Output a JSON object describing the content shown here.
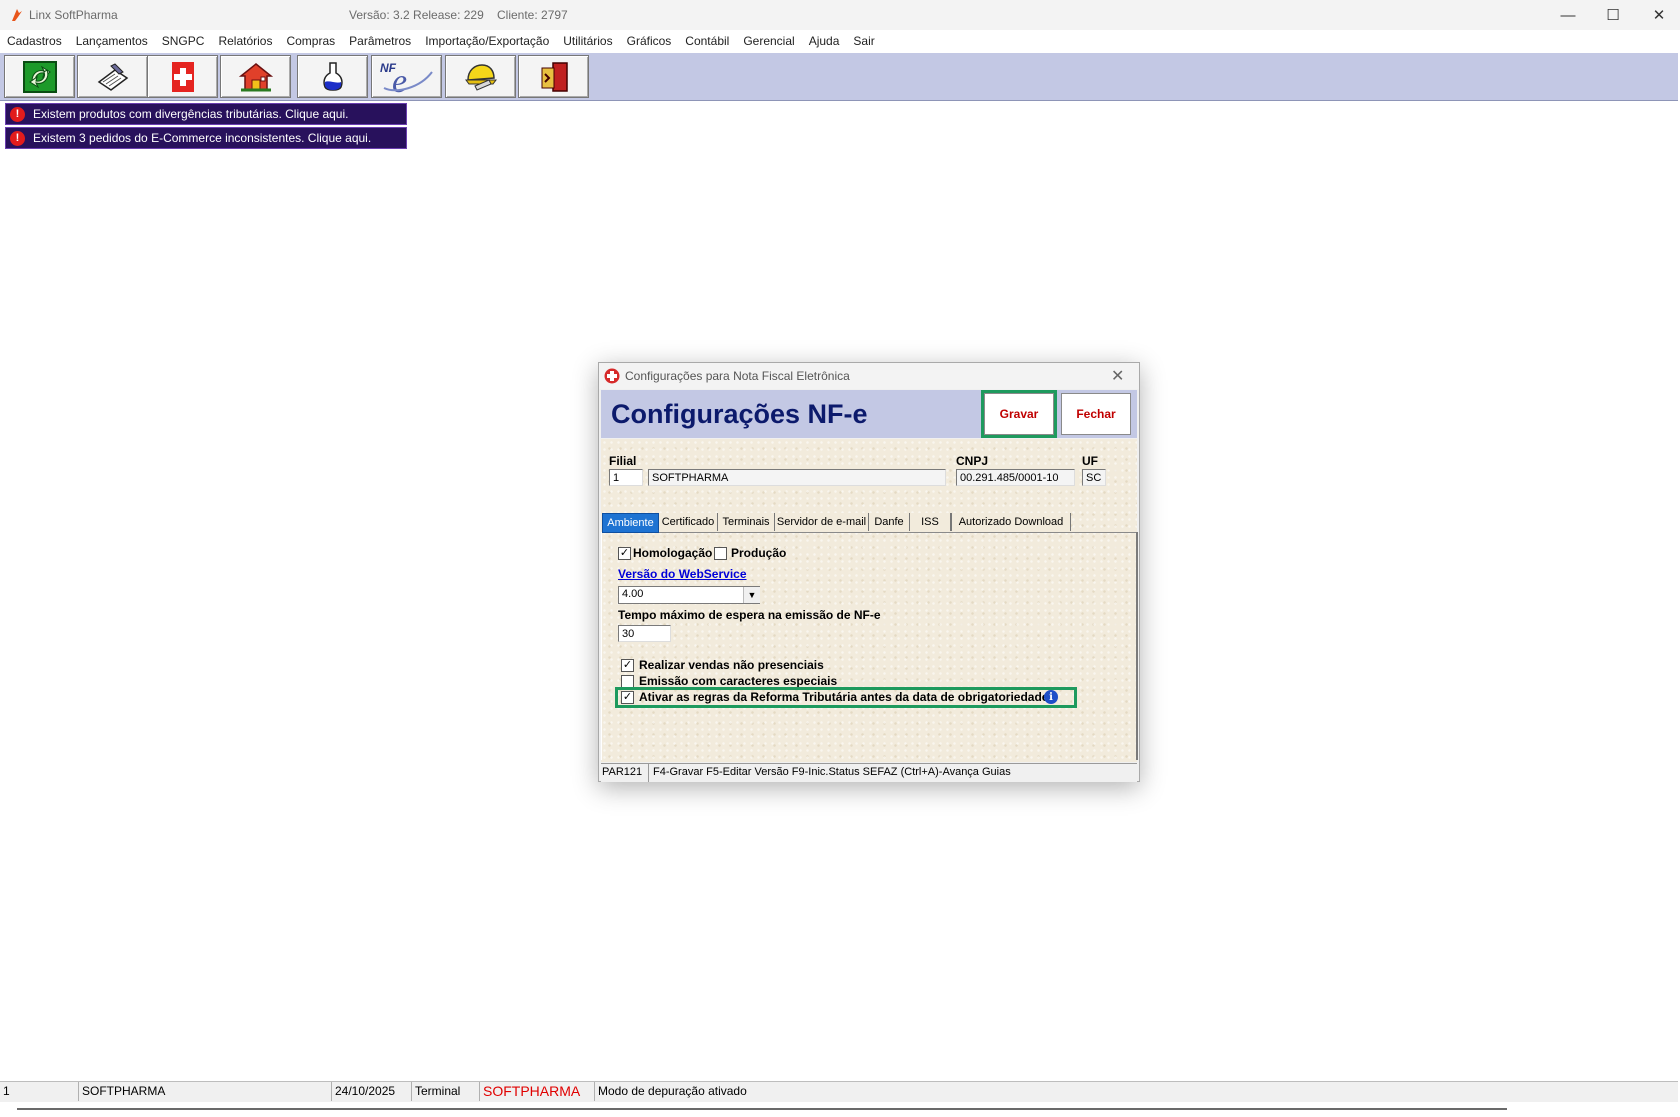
{
  "window": {
    "title": "Linx SoftPharma",
    "version": "Versão: 3.2 Release: 229",
    "client": "Cliente: 2797",
    "minimize": "—",
    "maximize": "☐",
    "close": "✕"
  },
  "menu": [
    "Cadastros",
    "Lançamentos",
    "SNGPC",
    "Relatórios",
    "Compras",
    "Parâmetros",
    "Importação/Exportação",
    "Utilitários",
    "Gráficos",
    "Contábil",
    "Gerencial",
    "Ajuda",
    "Sair"
  ],
  "toolbar_icons": [
    "refresh-icon",
    "notes-icon",
    "pharmacy-cross-icon",
    "home-icon",
    "flask-icon",
    "nfe-icon",
    "helmet-icon",
    "exit-door-icon"
  ],
  "alerts": [
    {
      "icon": "!",
      "text": "Existem produtos com divergências tributárias. Clique aqui."
    },
    {
      "icon": "!",
      "text": "Existem 3 pedidos do E-Commerce inconsistentes. Clique aqui."
    }
  ],
  "dialog": {
    "title": "Configurações para Nota Fiscal Eletrônica",
    "close": "✕",
    "heading": "Configurações NF-e",
    "btn_gravar": "Gravar",
    "btn_fechar": "Fechar",
    "filial_label": "Filial",
    "filial_code": "1",
    "filial_name": "SOFTPHARMA",
    "cnpj_label": "CNPJ",
    "cnpj": "00.291.485/0001-10",
    "uf_label": "UF",
    "uf": "SC",
    "tabs": [
      "Ambiente",
      "Certificado",
      "Terminais",
      "Servidor de e-mail",
      "Danfe",
      "ISS",
      "Autorizado Download"
    ],
    "active_tab": "Ambiente",
    "homologacao_label": "Homologação",
    "homologacao_checked": true,
    "producao_label": "Produção",
    "producao_checked": false,
    "webservice_label": "Versão do WebService",
    "webservice_version": "4.00",
    "tempo_label": "Tempo máximo de espera na emissão de NF-e",
    "tempo_value": "30",
    "vendas_label": "Realizar vendas não presenciais",
    "vendas_checked": true,
    "especiais_label": "Emissão com caracteres especiais",
    "especiais_checked": false,
    "reforma_label": "Ativar as regras da Reforma Tributária antes da data de obrigatoriedade",
    "reforma_checked": true,
    "info_glyph": "i",
    "status_code": "PAR121",
    "status_shortcuts": "F4-Gravar  F5-Editar Versão  F9-Inic.Status SEFAZ  (Ctrl+A)-Avança Guias"
  },
  "statusbar": {
    "field1": "1",
    "company": "SOFTPHARMA",
    "date": "24/10/2025",
    "terminal": "Terminal",
    "brand": "SOFTPHARMA",
    "mode": "Modo de depuração ativado"
  },
  "colors": {
    "accent_green": "#1e9a5e",
    "header_bg": "#c3c8e4",
    "heading_text": "#0c1a6c",
    "alert_bg": "#28115c",
    "brand_red": "#e00000"
  }
}
